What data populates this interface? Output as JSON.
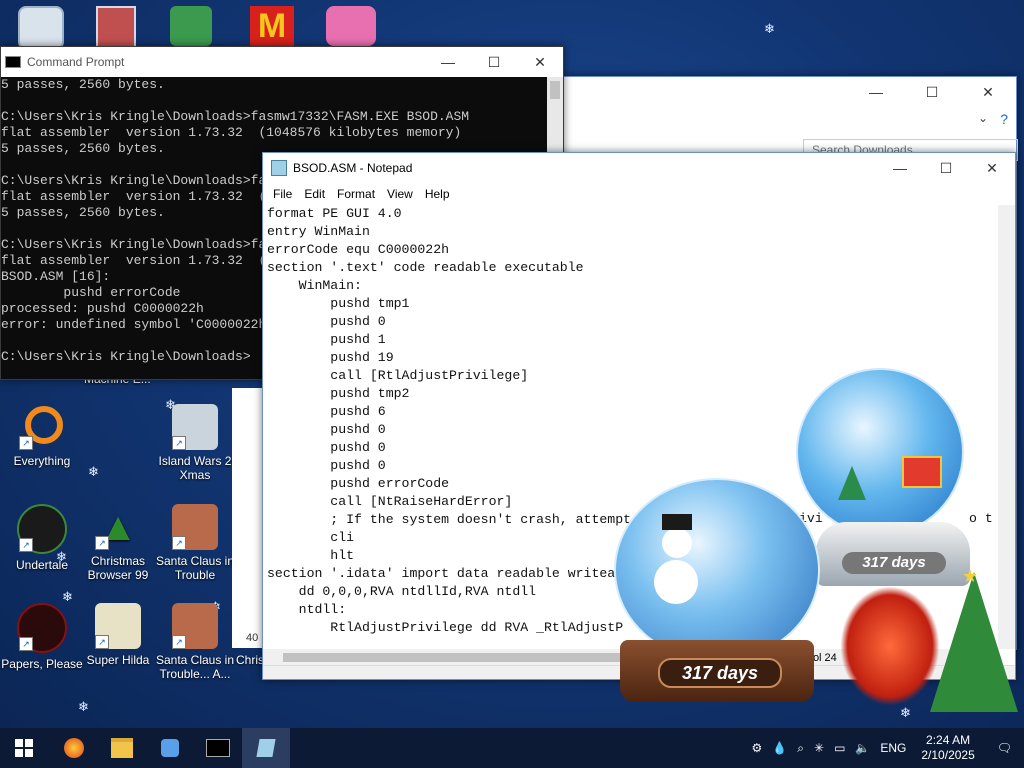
{
  "desktop": {
    "icons": [
      {
        "label": "Everything",
        "color": "#f08a1c"
      },
      {
        "label": "Island Wars 2 Xmas",
        "color": "#c9d4dc"
      },
      {
        "label": "Undertale",
        "color": "#3a8a3a"
      },
      {
        "label": "Christmas Browser 99",
        "color": "#2b8b2b"
      },
      {
        "label": "Santa Claus in Trouble",
        "color": "#b86a4a"
      },
      {
        "label": "Papers, Please",
        "color": "#8a1010"
      },
      {
        "label": "Super Hilda",
        "color": "#e7e1c5"
      },
      {
        "label": "Santa Claus in Trouble... A...",
        "color": "#b86a4a"
      }
    ],
    "partial_label": "Machine E...",
    "partial_label2": "Chris",
    "bg_window_search": "Search Downloads",
    "bg_window_count": "40"
  },
  "cmd": {
    "title": "Command Prompt",
    "lines": [
      "5 passes, 2560 bytes.",
      "",
      "C:\\Users\\Kris Kringle\\Downloads>fasmw17332\\FASM.EXE BSOD.ASM",
      "flat assembler  version 1.73.32  (1048576 kilobytes memory)",
      "5 passes, 2560 bytes.",
      "",
      "C:\\Users\\Kris Kringle\\Downloads>fa",
      "flat assembler  version 1.73.32  (",
      "5 passes, 2560 bytes.",
      "",
      "C:\\Users\\Kris Kringle\\Downloads>fa",
      "flat assembler  version 1.73.32  (",
      "BSOD.ASM [16]:",
      "        pushd errorCode",
      "processed: pushd C0000022h",
      "error: undefined symbol 'C0000022h",
      "",
      "C:\\Users\\Kris Kringle\\Downloads>"
    ]
  },
  "notepad": {
    "title": "BSOD.ASM - Notepad",
    "menu": [
      "File",
      "Edit",
      "Format",
      "View",
      "Help"
    ],
    "lines": [
      "format PE GUI 4.0",
      "entry WinMain",
      "errorCode equ C0000022h",
      "section '.text' code readable executable",
      "    WinMain:",
      "        pushd tmp1",
      "        pushd 0",
      "        pushd 1",
      "        pushd 19",
      "        call [RtlAdjustPrivilege]",
      "        pushd tmp2",
      "        pushd 6",
      "        pushd 0",
      "        pushd 0",
      "        pushd 0",
      "        pushd errorCode",
      "        call [NtRaiseHardError]",
      "        ; If the system doesn't crash, attempt",
      "        cli",
      "        hlt",
      "section '.idata' import data readable writea",
      "    dd 0,0,0,RVA ntdllId,RVA ntdll",
      "    ntdll:",
      "        RtlAdjustPrivilege dd RVA _RtlAdjustP"
    ],
    "overflow_text": "ivi",
    "overflow_text2": "o t",
    "status_col": "Col 24"
  },
  "widgets": {
    "globe1_days": "317 days",
    "globe2_days": "317 days"
  },
  "taskbar": {
    "lang": "ENG",
    "time": "2:24 AM",
    "date": "2/10/2025"
  }
}
